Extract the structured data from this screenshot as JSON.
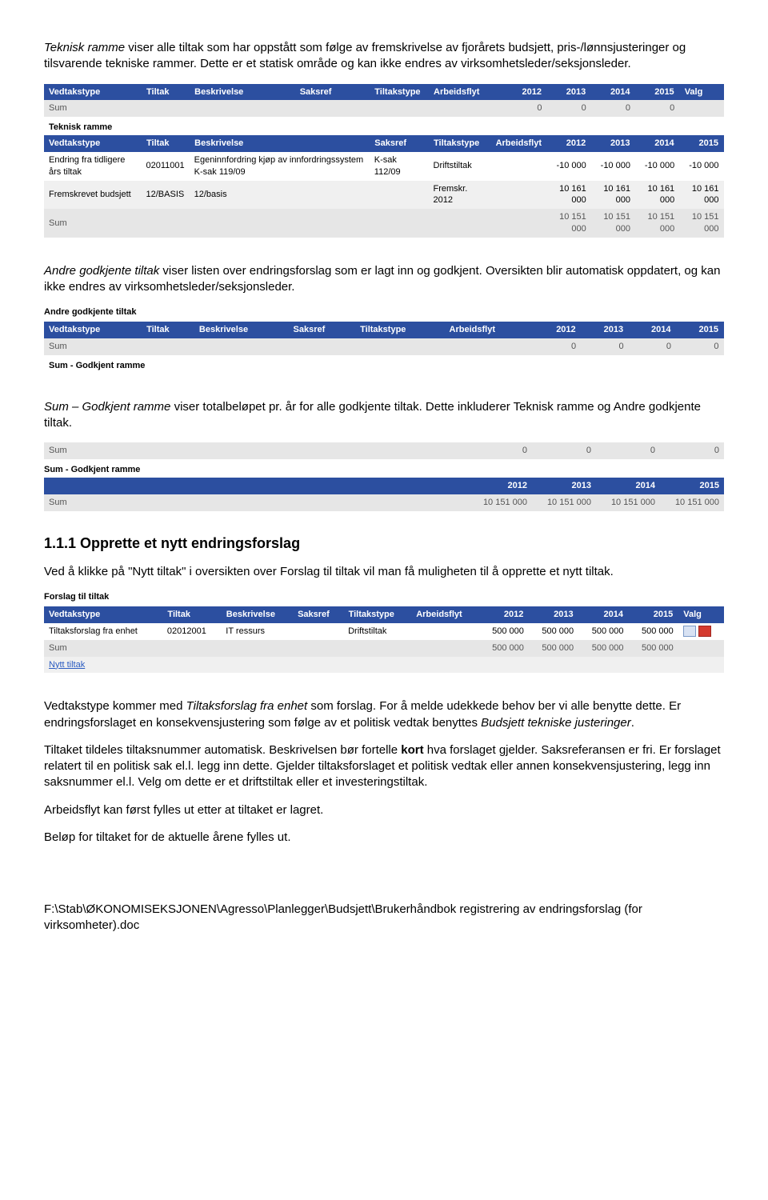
{
  "para1": {
    "a": "Teknisk ramme",
    "b": " viser alle tiltak som har oppstått som følge av fremskrivelse av fjorårets budsjett, pris-/lønnsjusteringer og tilsvarende tekniske rammer. Dette er et statisk område og kan ikke endres av virksomhetsleder/seksjonsleder."
  },
  "table1": {
    "header_row": [
      "Vedtakstype",
      "Tiltak",
      "Beskrivelse",
      "Saksref",
      "Tiltakstype",
      "Arbeidsflyt",
      "2012",
      "2013",
      "2014",
      "2015",
      "Valg"
    ],
    "sum_row": [
      "Sum",
      "",
      "",
      "",
      "",
      "",
      "0",
      "0",
      "0",
      "0",
      ""
    ],
    "section_title": "Teknisk ramme",
    "header2": [
      "Vedtakstype",
      "Tiltak",
      "Beskrivelse",
      "Saksref",
      "Tiltakstype",
      "Arbeidsflyt",
      "2012",
      "2013",
      "2014",
      "2015"
    ],
    "r1": [
      "Endring fra tidligere års tiltak",
      "02011001",
      "Egeninnfordring kjøp av innfordringssystem K-sak 119/09",
      "K-sak 112/09",
      "Driftstiltak",
      "",
      "-10 000",
      "-10 000",
      "-10 000",
      "-10 000"
    ],
    "r2": [
      "Fremskrevet budsjett",
      "12/BASIS",
      "12/basis",
      "",
      "Fremskr. 2012",
      "",
      "10 161 000",
      "10 161 000",
      "10 161 000",
      "10 161 000"
    ],
    "sum2": [
      "Sum",
      "",
      "",
      "",
      "",
      "",
      "10 151 000",
      "10 151 000",
      "10 151 000",
      "10 151 000"
    ]
  },
  "para2": {
    "a": "Andre godkjente tiltak",
    "b": " viser listen over endringsforslag som er lagt inn og godkjent. Oversikten blir automatisk oppdatert, og kan ikke endres av virksomhetsleder/seksjonsleder."
  },
  "table2": {
    "section_title": "Andre godkjente tiltak",
    "header": [
      "Vedtakstype",
      "Tiltak",
      "Beskrivelse",
      "Saksref",
      "Tiltakstype",
      "Arbeidsflyt",
      "2012",
      "2013",
      "2014",
      "2015"
    ],
    "sum": [
      "Sum",
      "",
      "",
      "",
      "",
      "",
      "0",
      "0",
      "0",
      "0"
    ],
    "footer_label": "Sum - Godkjent ramme"
  },
  "para3": {
    "a": "Sum – Godkjent ramme",
    "b": " viser totalbeløpet pr. år for alle godkjente tiltak. Dette inkluderer Teknisk ramme og Andre godkjente tiltak."
  },
  "table3": {
    "top_sum": [
      "Sum",
      "0",
      "0",
      "0",
      "0"
    ],
    "label": "Sum - Godkjent ramme",
    "header": [
      "",
      "2012",
      "2013",
      "2014",
      "2015"
    ],
    "sum": [
      "Sum",
      "10 151 000",
      "10 151 000",
      "10 151 000",
      "10 151 000"
    ]
  },
  "heading111": "1.1.1  Opprette et nytt endringsforslag",
  "para4": "Ved å klikke på \"Nytt tiltak\" i oversikten over Forslag til tiltak vil man få muligheten til å opprette et nytt tiltak.",
  "table4": {
    "section_title": "Forslag til tiltak",
    "header": [
      "Vedtakstype",
      "Tiltak",
      "Beskrivelse",
      "Saksref",
      "Tiltakstype",
      "Arbeidsflyt",
      "2012",
      "2013",
      "2014",
      "2015",
      "Valg"
    ],
    "r1": [
      "Tiltaksforslag fra enhet",
      "02012001",
      "IT ressurs",
      "",
      "Driftstiltak",
      "",
      "500 000",
      "500 000",
      "500 000",
      "500 000"
    ],
    "sum": [
      "Sum",
      "",
      "",
      "",
      "",
      "",
      "500 000",
      "500 000",
      "500 000",
      "500 000",
      ""
    ],
    "newrow": "Nytt tiltak"
  },
  "para5": {
    "a": "Vedtakstype kommer med ",
    "b": "Tiltaksforslag fra enhet",
    "c": " som forslag. For å melde udekkede behov ber vi alle benytte dette. Er endringsforslaget en konsekvensjustering som følge av et politisk vedtak benyttes ",
    "d": "Budsjett tekniske justeringer",
    "e": "."
  },
  "para6": {
    "a": "Tiltaket tildeles tiltaksnummer automatisk. Beskrivelsen bør fortelle ",
    "b": "kort",
    "c": " hva forslaget gjelder. Saksreferansen er fri. Er forslaget relatert til en politisk sak el.l. legg inn dette. Gjelder tiltaksforslaget et politisk vedtak eller annen konsekvensjustering, legg inn saksnummer el.l. Velg om dette er et driftstiltak eller et investeringstiltak."
  },
  "para7": "Arbeidsflyt kan først fylles ut etter at tiltaket er lagret.",
  "para8": "Beløp for tiltaket for de aktuelle årene fylles ut.",
  "footer": "F:\\Stab\\ØKONOMISEKSJONEN\\Agresso\\Planlegger\\Budsjett\\Brukerhåndbok registrering av endringsforslag (for virksomheter).doc"
}
